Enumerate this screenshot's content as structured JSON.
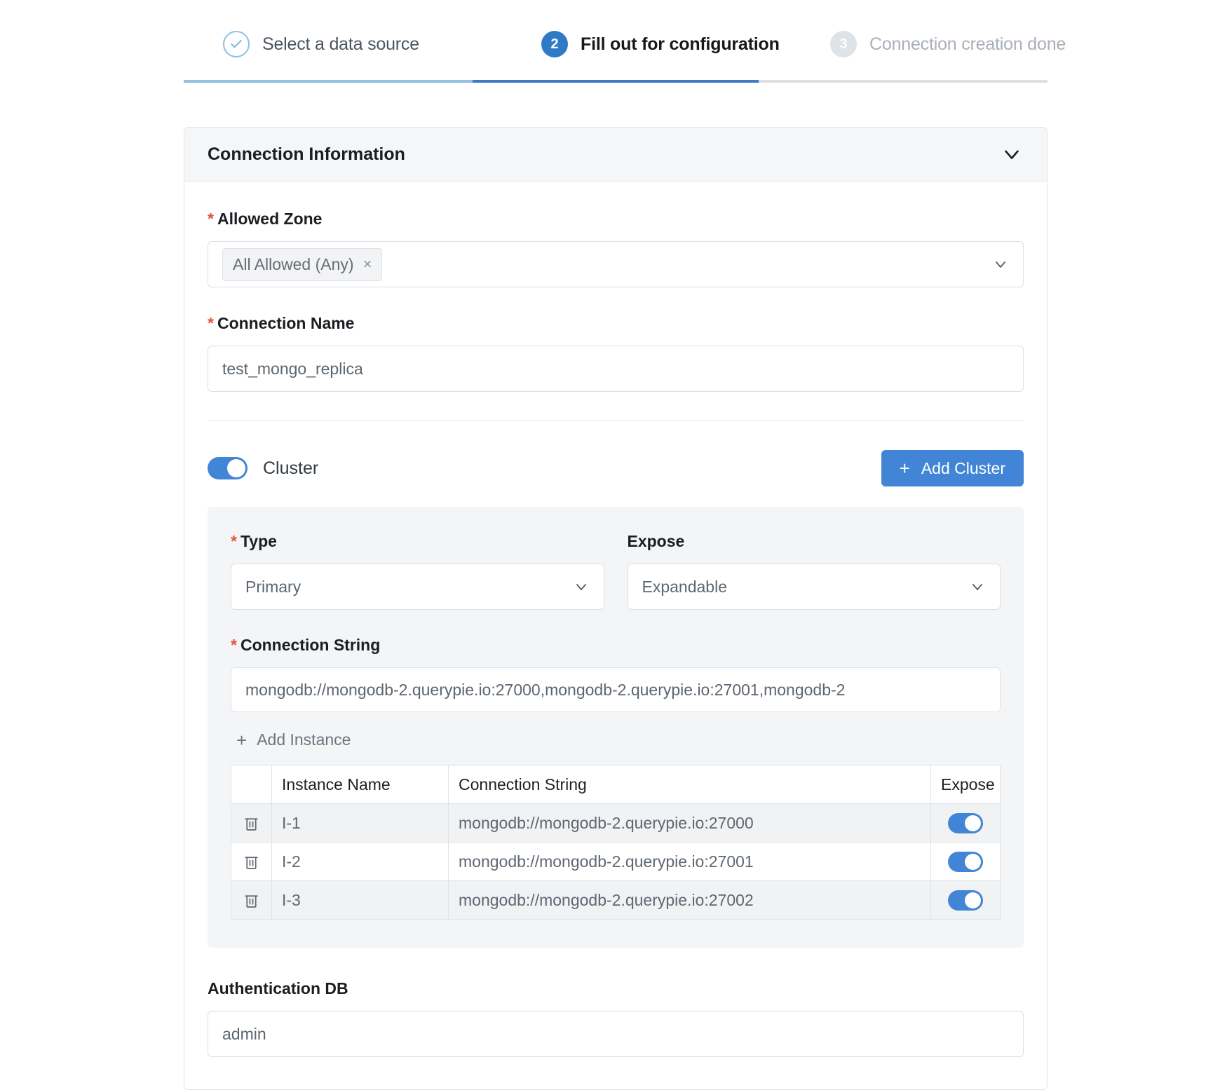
{
  "stepper": {
    "steps": [
      {
        "marker": "check-icon",
        "label": "Select a data source",
        "state": "done"
      },
      {
        "marker": "2",
        "label": "Fill out for configuration",
        "state": "active"
      },
      {
        "marker": "3",
        "label": "Connection creation done",
        "state": "idle"
      }
    ]
  },
  "card": {
    "title": "Connection Information",
    "collapse_icon": "chevron-down-icon"
  },
  "allowed_zone": {
    "label": "Allowed Zone",
    "required_mark": "*",
    "chip": "All Allowed (Any)",
    "chip_remove": "×"
  },
  "connection_name": {
    "label": "Connection Name",
    "required_mark": "*",
    "value": "test_mongo_replica"
  },
  "cluster": {
    "toggle_label": "Cluster",
    "toggle_on": true,
    "add_button": "Add Cluster",
    "add_button_icon": "plus-icon",
    "type": {
      "label": "Type",
      "required_mark": "*",
      "value": "Primary"
    },
    "expose": {
      "label": "Expose",
      "value": "Expandable"
    },
    "connection_string": {
      "label": "Connection String",
      "required_mark": "*",
      "value": "mongodb://mongodb-2.querypie.io:27000,mongodb-2.querypie.io:27001,mongodb-2"
    },
    "add_instance": "Add Instance",
    "add_instance_icon": "plus-icon",
    "table": {
      "columns": [
        "",
        "Instance Name",
        "Connection String",
        "Expose"
      ],
      "rows": [
        {
          "name": "I-1",
          "connection_string": "mongodb://mongodb-2.querypie.io:27000",
          "expose": true
        },
        {
          "name": "I-2",
          "connection_string": "mongodb://mongodb-2.querypie.io:27001",
          "expose": true
        },
        {
          "name": "I-3",
          "connection_string": "mongodb://mongodb-2.querypie.io:27002",
          "expose": true
        }
      ]
    }
  },
  "auth_db": {
    "label": "Authentication DB",
    "value": "admin"
  },
  "colors": {
    "accent": "#4285d6",
    "step_active": "#2f7ac7",
    "required": "#e0543c",
    "panel_bg": "#f4f5f7"
  }
}
